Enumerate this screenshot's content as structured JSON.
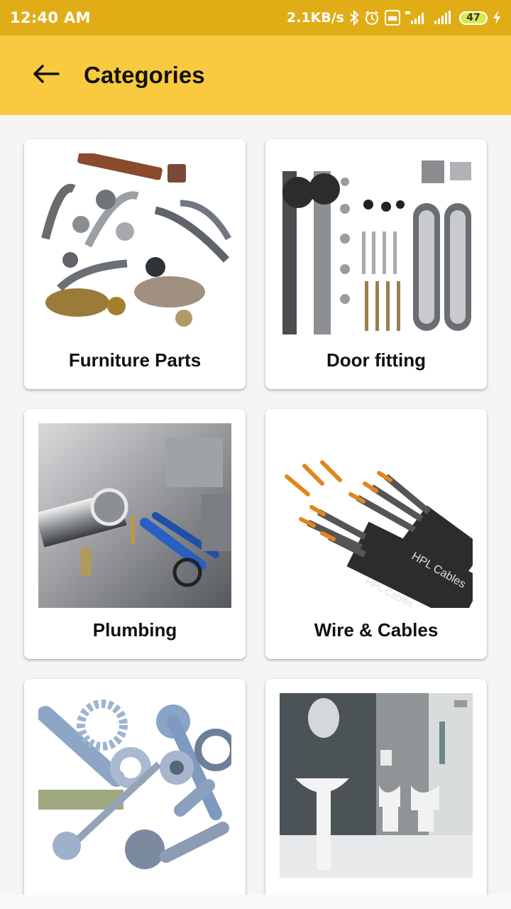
{
  "status_bar": {
    "time": "12:40 AM",
    "net_speed": "2.1KB/s",
    "battery": "47"
  },
  "app_bar": {
    "title": "Categories",
    "back_icon": "arrow-left-icon"
  },
  "categories": [
    {
      "label": "Furniture Parts",
      "image": "furniture-handles-and-knobs"
    },
    {
      "label": "Door fitting",
      "image": "sliding-door-hardware"
    },
    {
      "label": "Plumbing",
      "image": "plumbing-pipes-and-tools"
    },
    {
      "label": "Wire & Cables",
      "image": "hpl-cables"
    },
    {
      "label": "",
      "image": "nuts-bolts-washers"
    },
    {
      "label": "",
      "image": "bathroom-sanitaryware"
    }
  ],
  "colors": {
    "status_bar": "#e0ad17",
    "app_bar": "#f9ca3f",
    "background": "#f5f5f5"
  }
}
